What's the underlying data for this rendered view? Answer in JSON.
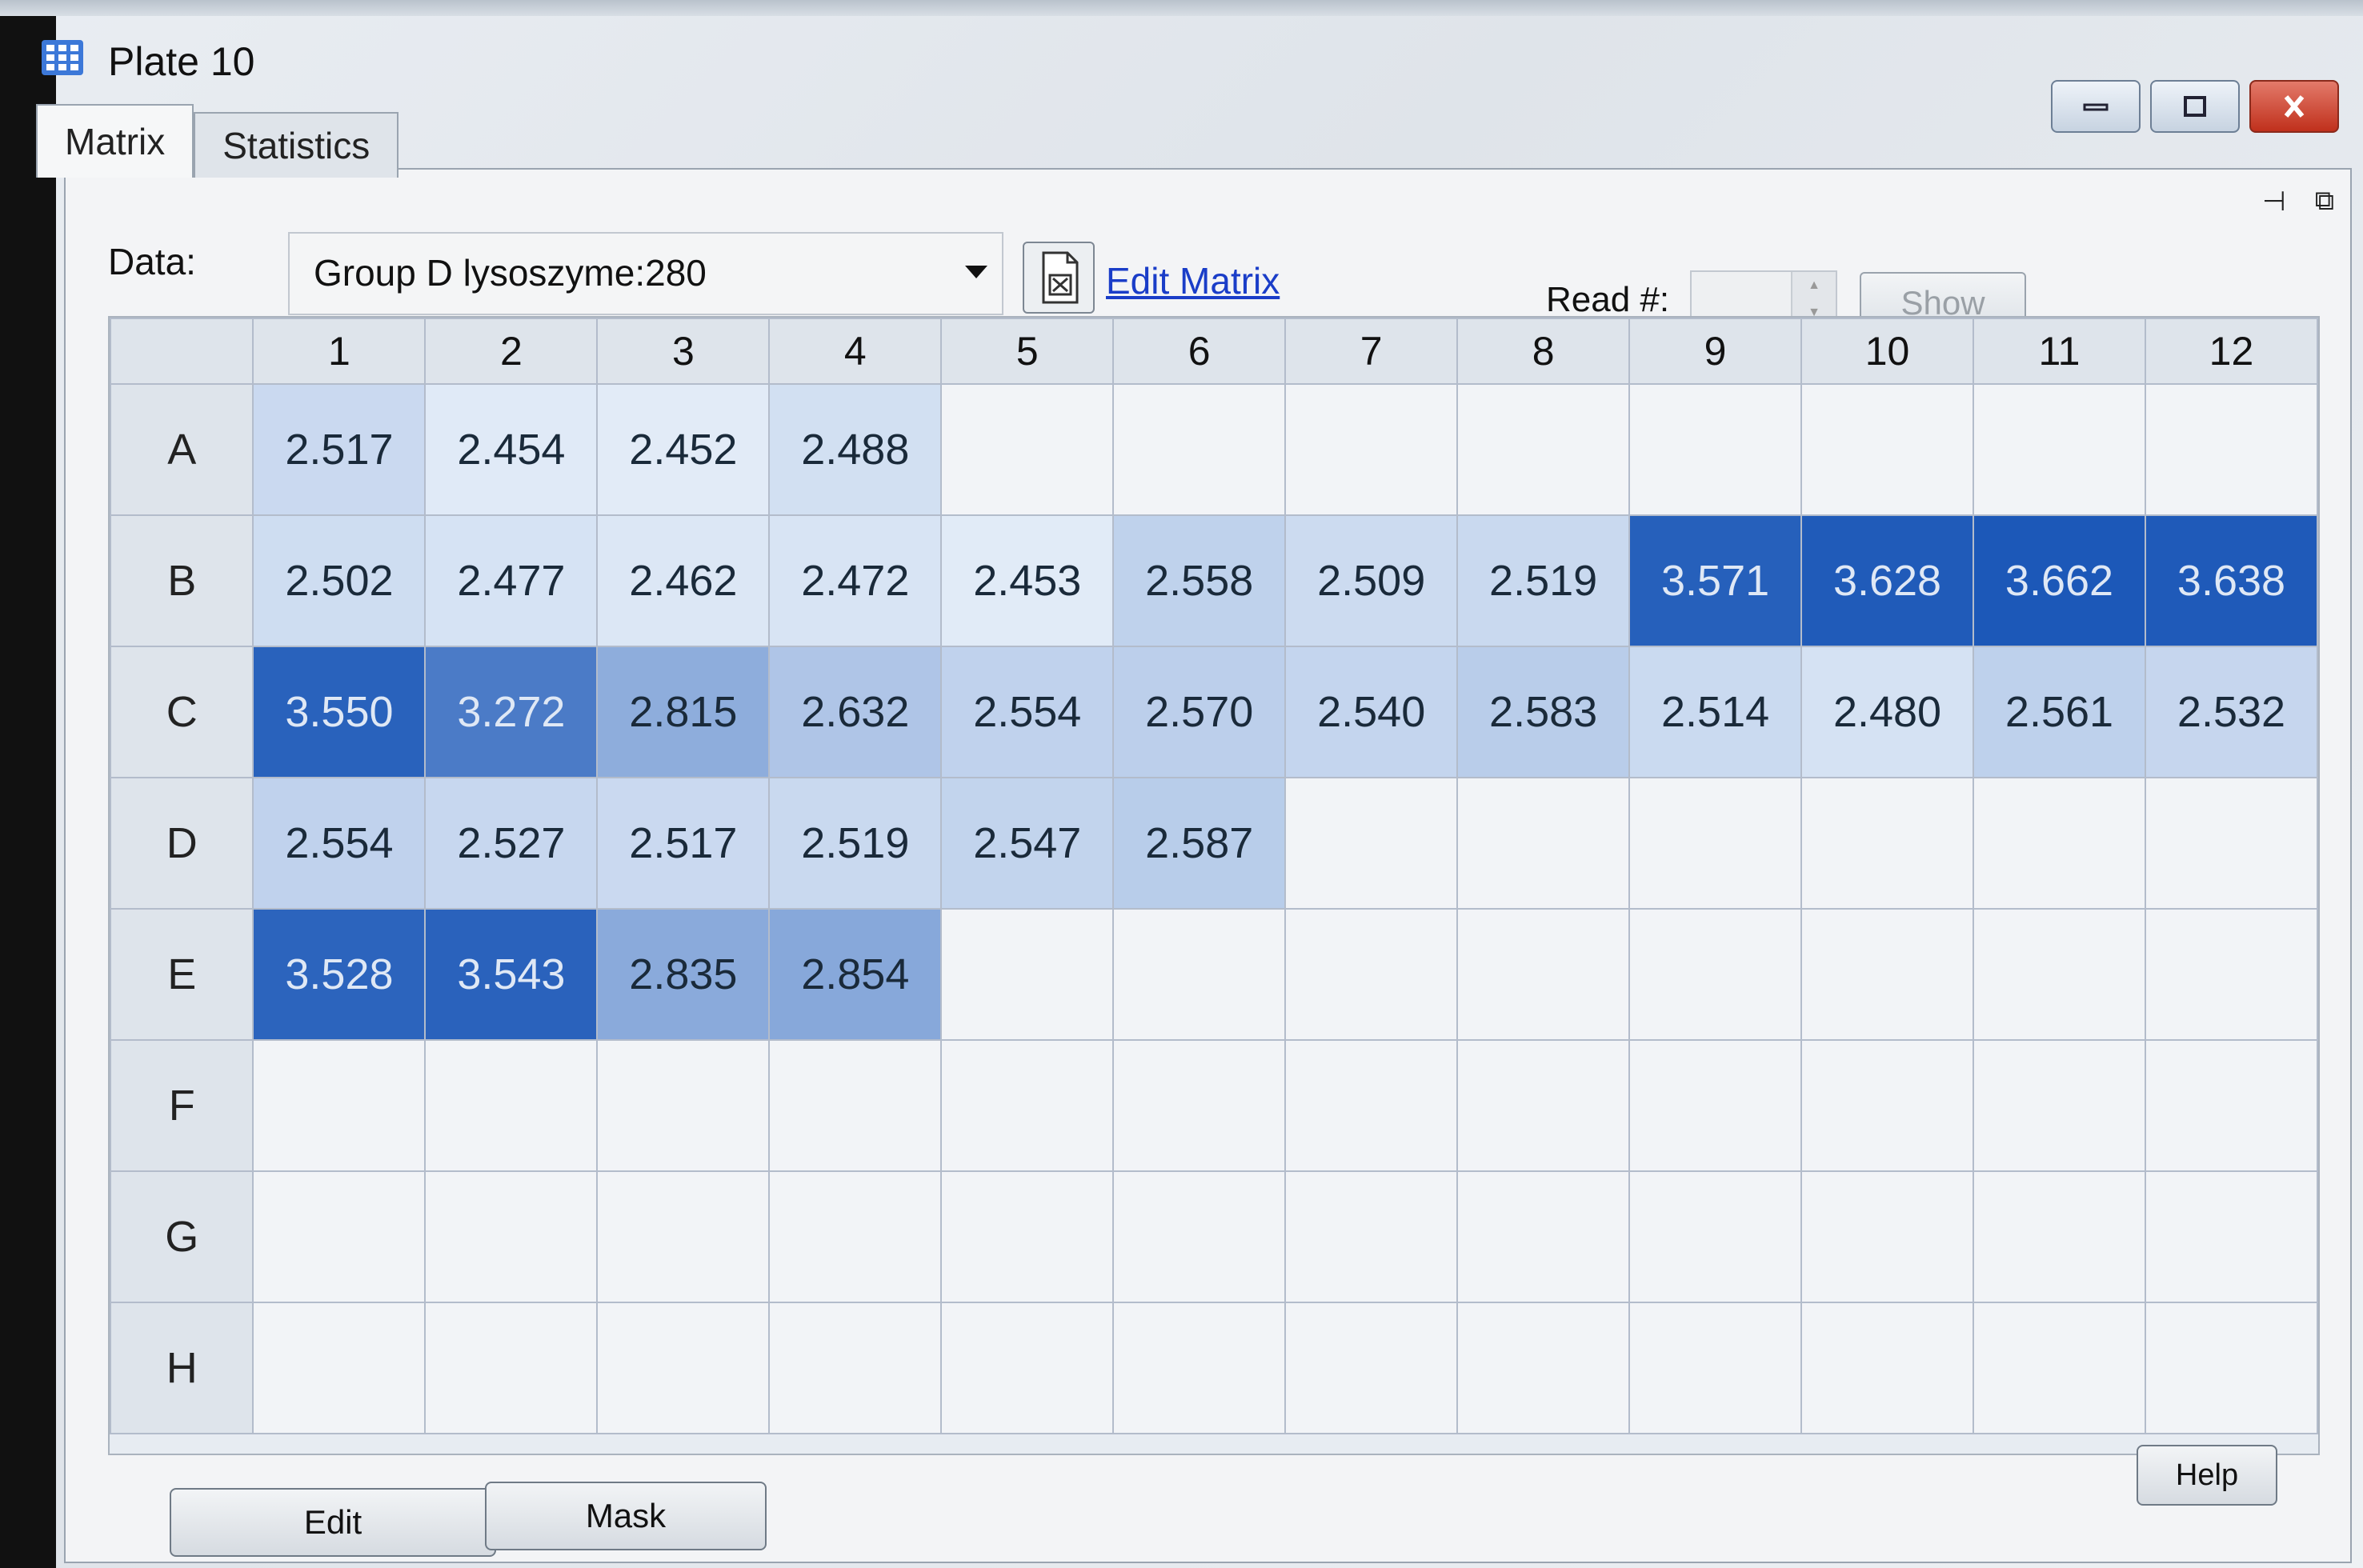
{
  "window": {
    "title": "Plate 10",
    "controls": {
      "minimize": "minimize-icon",
      "maximize": "maximize-icon",
      "close": "close-icon"
    }
  },
  "tabs": [
    {
      "label": "Matrix",
      "active": true
    },
    {
      "label": "Statistics",
      "active": false
    }
  ],
  "toolbar": {
    "data_label": "Data:",
    "data_value": "Group D lysoszyme:280",
    "edit_matrix_label": "Edit Matrix",
    "read_label": "Read #:",
    "read_value": "",
    "show_label": "Show"
  },
  "plate": {
    "columns": [
      "1",
      "2",
      "3",
      "4",
      "5",
      "6",
      "7",
      "8",
      "9",
      "10",
      "11",
      "12"
    ],
    "rows": [
      {
        "label": "A",
        "values": [
          "2.517",
          "2.454",
          "2.452",
          "2.488",
          "",
          "",
          "",
          "",
          "",
          "",
          "",
          ""
        ]
      },
      {
        "label": "B",
        "values": [
          "2.502",
          "2.477",
          "2.462",
          "2.472",
          "2.453",
          "2.558",
          "2.509",
          "2.519",
          "3.571",
          "3.628",
          "3.662",
          "3.638"
        ]
      },
      {
        "label": "C",
        "values": [
          "3.550",
          "3.272",
          "2.815",
          "2.632",
          "2.554",
          "2.570",
          "2.540",
          "2.583",
          "2.514",
          "2.480",
          "2.561",
          "2.532"
        ]
      },
      {
        "label": "D",
        "values": [
          "2.554",
          "2.527",
          "2.517",
          "2.519",
          "2.547",
          "2.587",
          "",
          "",
          "",
          "",
          "",
          ""
        ]
      },
      {
        "label": "E",
        "values": [
          "3.528",
          "3.543",
          "2.835",
          "2.854",
          "",
          "",
          "",
          "",
          "",
          "",
          "",
          ""
        ]
      },
      {
        "label": "F",
        "values": [
          "",
          "",
          "",
          "",
          "",
          "",
          "",
          "",
          "",
          "",
          "",
          ""
        ]
      },
      {
        "label": "G",
        "values": [
          "",
          "",
          "",
          "",
          "",
          "",
          "",
          "",
          "",
          "",
          "",
          ""
        ]
      },
      {
        "label": "H",
        "values": [
          "",
          "",
          "",
          "",
          "",
          "",
          "",
          "",
          "",
          "",
          "",
          ""
        ]
      }
    ],
    "heat_colors": {
      "low": "#e4edf8",
      "high": "#1c58b8"
    }
  },
  "buttons": {
    "edit_label": "Edit",
    "mask_label": "Mask",
    "help_label": "Help"
  }
}
